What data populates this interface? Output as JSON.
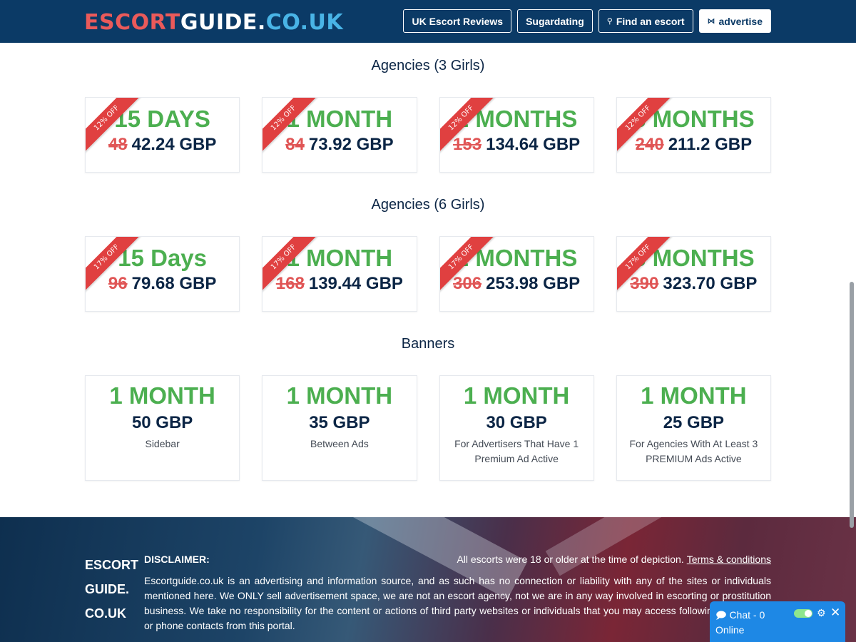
{
  "header": {
    "logo": {
      "part1": "ESCORT",
      "part2": "GUIDE.",
      "part3": "CO.UK"
    },
    "nav": [
      {
        "label": "UK Escort Reviews",
        "icon": ""
      },
      {
        "label": "Sugardating",
        "icon": ""
      },
      {
        "label": "Find an escort",
        "icon": "search-icon"
      },
      {
        "label": "advertise",
        "icon": "bowtie-icon"
      }
    ]
  },
  "sections": [
    {
      "title": "Agencies (3 Girls)",
      "cards": [
        {
          "ribbon": "12% OFF",
          "duration": "15 DAYS",
          "old_price": "48",
          "price": "42.24 GBP"
        },
        {
          "ribbon": "12% OFF",
          "duration": "1 MONTH",
          "old_price": "84",
          "price": "73.92 GBP"
        },
        {
          "ribbon": "12% OFF",
          "duration": "2 MONTHS",
          "old_price": "153",
          "price": "134.64 GBP"
        },
        {
          "ribbon": "12% OFF",
          "duration": "3 MONTHS",
          "old_price": "240",
          "price": "211.2 GBP"
        }
      ]
    },
    {
      "title": "Agencies (6 Girls)",
      "cards": [
        {
          "ribbon": "17% OFF",
          "duration": "15 Days",
          "old_price": "96",
          "price": "79.68 GBP"
        },
        {
          "ribbon": "17% OFF",
          "duration": "1 MONTH",
          "old_price": "168",
          "price": "139.44 GBP"
        },
        {
          "ribbon": "17% OFF",
          "duration": "2 MONTHS",
          "old_price": "306",
          "price": "253.98 GBP"
        },
        {
          "ribbon": "17% OFF",
          "duration": "3 MONTHS",
          "old_price": "390",
          "price": "323.70 GBP"
        }
      ]
    }
  ],
  "banners": {
    "title": "Banners",
    "cards": [
      {
        "duration": "1 MONTH",
        "price": "50 GBP",
        "desc": "Sidebar"
      },
      {
        "duration": "1 MONTH",
        "price": "35 GBP",
        "desc": "Between Ads"
      },
      {
        "duration": "1 MONTH",
        "price": "30 GBP",
        "desc": "For Advertisers That Have 1 Premium Ad Active"
      },
      {
        "duration": "1 MONTH",
        "price": "25 GBP",
        "desc": "For Agencies With At Least 3 PREMIUM Ads Active"
      }
    ]
  },
  "footer": {
    "logo_lines": [
      "ESCORT",
      "GUIDE.",
      "CO.UK"
    ],
    "disclaimer_title": "DISCLAIMER:",
    "age_notice": "All escorts were 18 or older at the time of depiction.",
    "terms_link": "Terms & conditions",
    "disclaimer_text": "Escortguide.co.uk is an advertising and information source, and as such has no connection or liability with any of the sites or individuals mentioned here. We ONLY sell advertisement space, we are not an escort agency, not we are in any way involved in escorting or prostitution business. We take no responsibility for the content or actions of third party websites or individuals that you may access following links, email or phone contacts from this portal."
  },
  "chat": {
    "label": "Chat - 0 Online",
    "icon": "chat-bubble-icon"
  },
  "colors": {
    "header_bg": "#0b3a66",
    "accent_green": "#4caf50",
    "ribbon_red": "#e04040",
    "chat_blue": "#1e88e5"
  }
}
